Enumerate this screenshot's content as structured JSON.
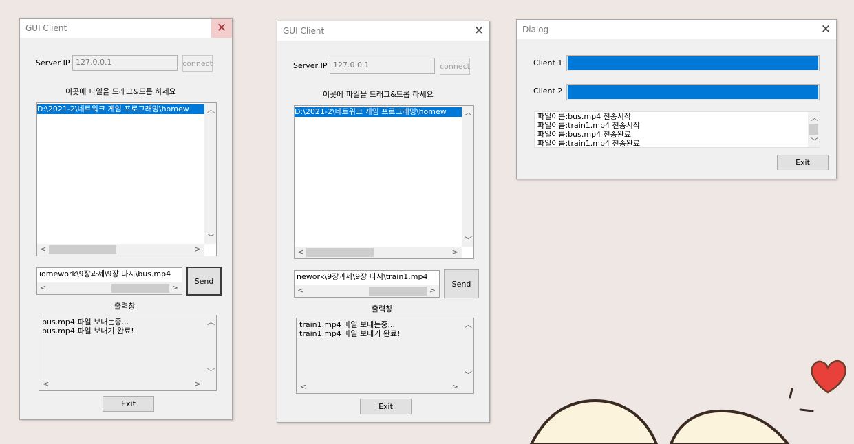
{
  "win1": {
    "title": "GUI Client",
    "server_ip_label": "Server IP",
    "server_ip_value": "127.0.0.1",
    "connect_label": "connect",
    "drop_hint": "이곳에 파일을 드래그&드롭 하세요",
    "file_list": [
      "D:\\2021-2\\네트워크 게임 프로그래밍\\homew"
    ],
    "path_value": "ıomework\\9장과제\\9장 다시\\bus.mp4",
    "send_label": "Send",
    "output_label": "출력창",
    "output_lines": [
      "bus.mp4 파일 보내는중...",
      "bus.mp4 파일 보내기 완료!"
    ],
    "exit_label": "Exit"
  },
  "win2": {
    "title": "GUI Client",
    "server_ip_label": "Server IP",
    "server_ip_value": "127.0.0.1",
    "connect_label": "connect",
    "drop_hint": "이곳에 파일을 드래그&드롭 하세요",
    "file_list": [
      "D:\\2021-2\\네트워크 게임 프로그래밍\\homew"
    ],
    "path_value": "nework\\9장과제\\9장 다시\\train1.mp4",
    "send_label": "Send",
    "output_label": "출력창",
    "output_lines": [
      "train1.mp4 파일 보내는중...",
      "train1.mp4 파일 보내기 완료!"
    ],
    "exit_label": "Exit"
  },
  "dialog": {
    "title": "Dialog",
    "client1_label": "Client 1",
    "client1_progress": 1.0,
    "client2_label": "Client 2",
    "client2_progress": 1.0,
    "log_lines": [
      "파일이름:bus.mp4 전송시작",
      "파일이름:train1.mp4 전송시작",
      "파일이름:bus.mp4 전송완료",
      "파일이름:train1.mp4 전송완료"
    ],
    "exit_label": "Exit"
  },
  "icons": {
    "close": "close-icon",
    "scroll_up": "chevron-up-icon",
    "scroll_down": "chevron-down-icon",
    "scroll_left": "chevron-left-icon",
    "scroll_right": "chevron-right-icon",
    "heart": "heart-icon"
  },
  "colors": {
    "accent": "#0078d7",
    "desktop": "#efe7e3",
    "heart": "#e8413c"
  }
}
